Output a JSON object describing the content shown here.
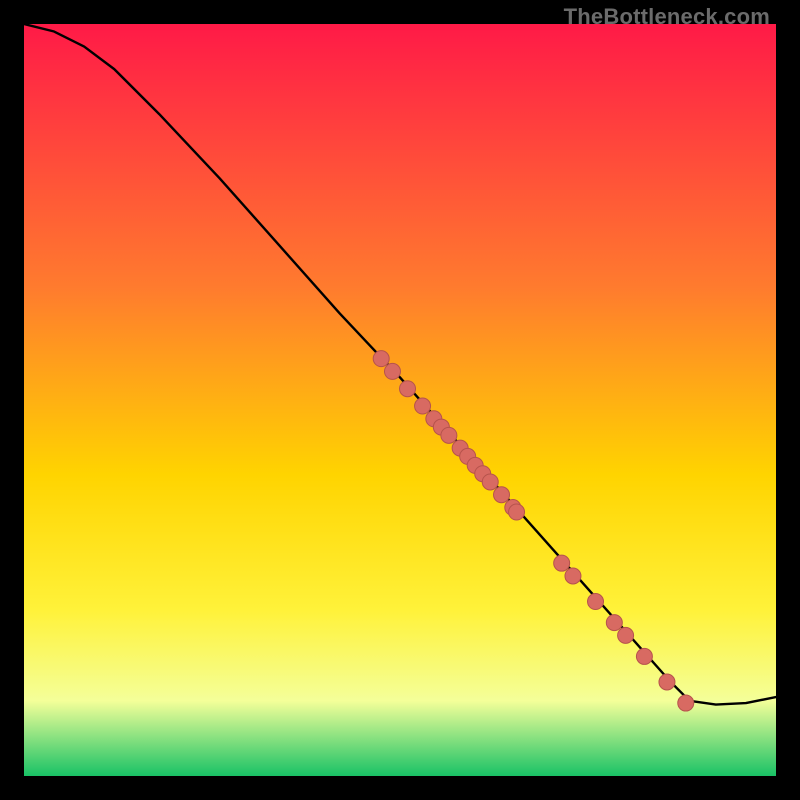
{
  "watermark": "TheBottleneck.com",
  "colors": {
    "gradient_top": "#ff1a47",
    "gradient_mid1": "#ff7b2e",
    "gradient_mid2": "#ffd400",
    "gradient_mid3": "#fff23a",
    "gradient_mid4": "#f4ff99",
    "gradient_bottom": "#19c266",
    "curve": "#000000",
    "dot_fill": "#d86a62",
    "dot_stroke": "#b6534c"
  },
  "chart_data": {
    "type": "line",
    "title": "",
    "xlabel": "",
    "ylabel": "",
    "xlim": [
      0,
      100
    ],
    "ylim": [
      0,
      100
    ],
    "curve": {
      "x": [
        0,
        4,
        8,
        12,
        18,
        26,
        34,
        42,
        50,
        58,
        66,
        74,
        82,
        86,
        88.5,
        92,
        96,
        100
      ],
      "y": [
        100,
        99,
        97,
        94,
        88,
        79.5,
        70.5,
        61.5,
        53,
        44,
        35,
        26,
        17,
        12.5,
        10,
        9.5,
        9.7,
        10.5
      ]
    },
    "series": [
      {
        "name": "dots",
        "x": [
          47.5,
          49.0,
          51.0,
          53.0,
          54.5,
          55.5,
          56.5,
          58.0,
          59.0,
          60.0,
          61.0,
          62.0,
          63.5,
          65.0,
          65.5,
          71.5,
          73.0,
          76.0,
          78.5,
          80.0,
          82.5,
          85.5,
          88.0
        ],
        "y": [
          55.5,
          53.8,
          51.5,
          49.2,
          47.5,
          46.4,
          45.3,
          43.6,
          42.5,
          41.3,
          40.2,
          39.1,
          37.4,
          35.7,
          35.1,
          28.3,
          26.6,
          23.2,
          20.4,
          18.7,
          15.9,
          12.5,
          9.7
        ]
      }
    ]
  }
}
